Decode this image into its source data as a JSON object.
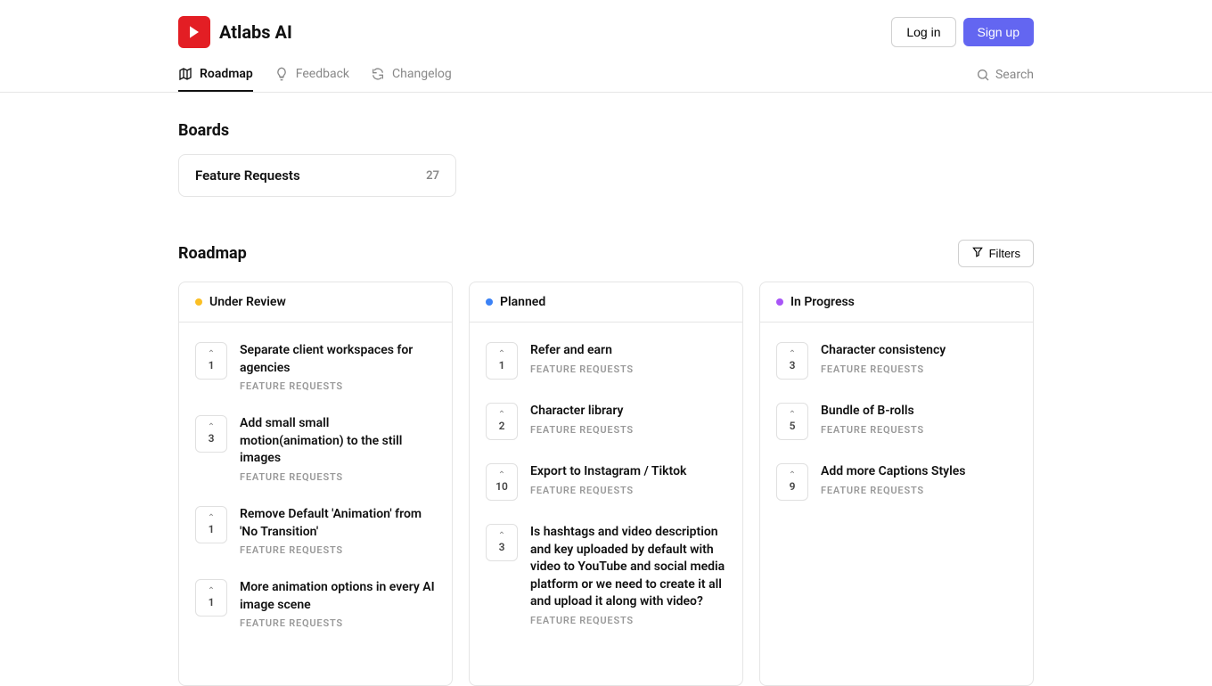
{
  "header": {
    "brand": "Atlabs AI",
    "login": "Log in",
    "signup": "Sign up"
  },
  "nav": {
    "roadmap": "Roadmap",
    "feedback": "Feedback",
    "changelog": "Changelog",
    "search": "Search"
  },
  "boards": {
    "heading": "Boards",
    "card": {
      "name": "Feature Requests",
      "count": "27"
    }
  },
  "roadmap": {
    "title": "Roadmap",
    "filters": "Filters"
  },
  "columns": {
    "under_review": {
      "title": "Under Review",
      "color": "#fbbf24",
      "cards": [
        {
          "votes": "1",
          "title": "Separate client workspaces for agencies",
          "label": "FEATURE REQUESTS"
        },
        {
          "votes": "3",
          "title": "Add small small motion(animation) to the still images",
          "label": "FEATURE REQUESTS"
        },
        {
          "votes": "1",
          "title": "Remove Default 'Animation' from 'No Transition'",
          "label": "FEATURE REQUESTS"
        },
        {
          "votes": "1",
          "title": "More animation options in every AI image scene",
          "label": "FEATURE REQUESTS"
        }
      ]
    },
    "planned": {
      "title": "Planned",
      "color": "#3b82f6",
      "cards": [
        {
          "votes": "1",
          "title": "Refer and earn",
          "label": "FEATURE REQUESTS"
        },
        {
          "votes": "2",
          "title": "Character library",
          "label": "FEATURE REQUESTS"
        },
        {
          "votes": "10",
          "title": "Export to Instagram / Tiktok",
          "label": "FEATURE REQUESTS"
        },
        {
          "votes": "3",
          "title": "Is hashtags and video description and key uploaded by default with video to YouTube and social media platform or we need to create it all and upload it along with video?",
          "label": "FEATURE REQUESTS"
        }
      ]
    },
    "in_progress": {
      "title": "In Progress",
      "color": "#a855f7",
      "cards": [
        {
          "votes": "3",
          "title": "Character consistency",
          "label": "FEATURE REQUESTS"
        },
        {
          "votes": "5",
          "title": "Bundle of B-rolls",
          "label": "FEATURE REQUESTS"
        },
        {
          "votes": "9",
          "title": "Add more Captions Styles",
          "label": "FEATURE REQUESTS"
        }
      ]
    }
  }
}
